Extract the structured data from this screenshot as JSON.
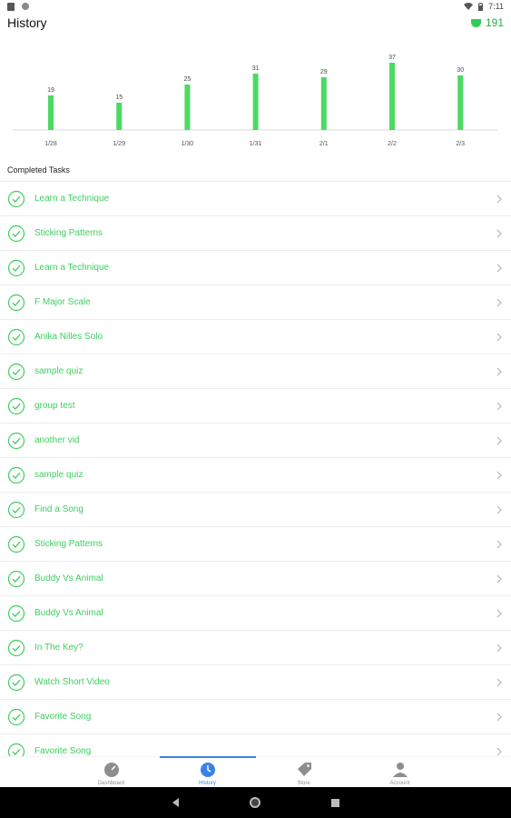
{
  "status_bar": {
    "time": "7:11"
  },
  "header": {
    "title": "History",
    "points": "191"
  },
  "chart_data": {
    "type": "bar",
    "categories": [
      "1/28",
      "1/29",
      "1/30",
      "1/31",
      "2/1",
      "2/2",
      "2/3"
    ],
    "values": [
      19,
      15,
      25,
      31,
      29,
      37,
      30
    ],
    "ylim": [
      0,
      40
    ],
    "grid": false,
    "colors": {
      "bar": "#4cd964"
    }
  },
  "section": {
    "title": "Completed Tasks"
  },
  "tasks": [
    {
      "label": "Learn a Technique"
    },
    {
      "label": "Sticking Patterns"
    },
    {
      "label": "Learn a Technique"
    },
    {
      "label": "F Major Scale"
    },
    {
      "label": "Anika Nilles Solo"
    },
    {
      "label": "sample quiz"
    },
    {
      "label": "group test"
    },
    {
      "label": "another vid"
    },
    {
      "label": "sample quiz"
    },
    {
      "label": "Find a Song"
    },
    {
      "label": "Sticking Patterns"
    },
    {
      "label": "Buddy Vs Animal"
    },
    {
      "label": "Buddy Vs Animal"
    },
    {
      "label": "In The Key?"
    },
    {
      "label": "Watch Short Video"
    },
    {
      "label": "Favorite Song"
    },
    {
      "label": "Favorite Song"
    }
  ],
  "tabs": [
    {
      "label": "Dashboard",
      "icon": "gauge-icon",
      "active": false
    },
    {
      "label": "History",
      "icon": "clock-icon",
      "active": true
    },
    {
      "label": "Store",
      "icon": "tag-icon",
      "active": false
    },
    {
      "label": "Account",
      "icon": "person-icon",
      "active": false
    }
  ],
  "colors": {
    "accent_green": "#3ecf5f",
    "tab_active": "#3b82e8"
  }
}
